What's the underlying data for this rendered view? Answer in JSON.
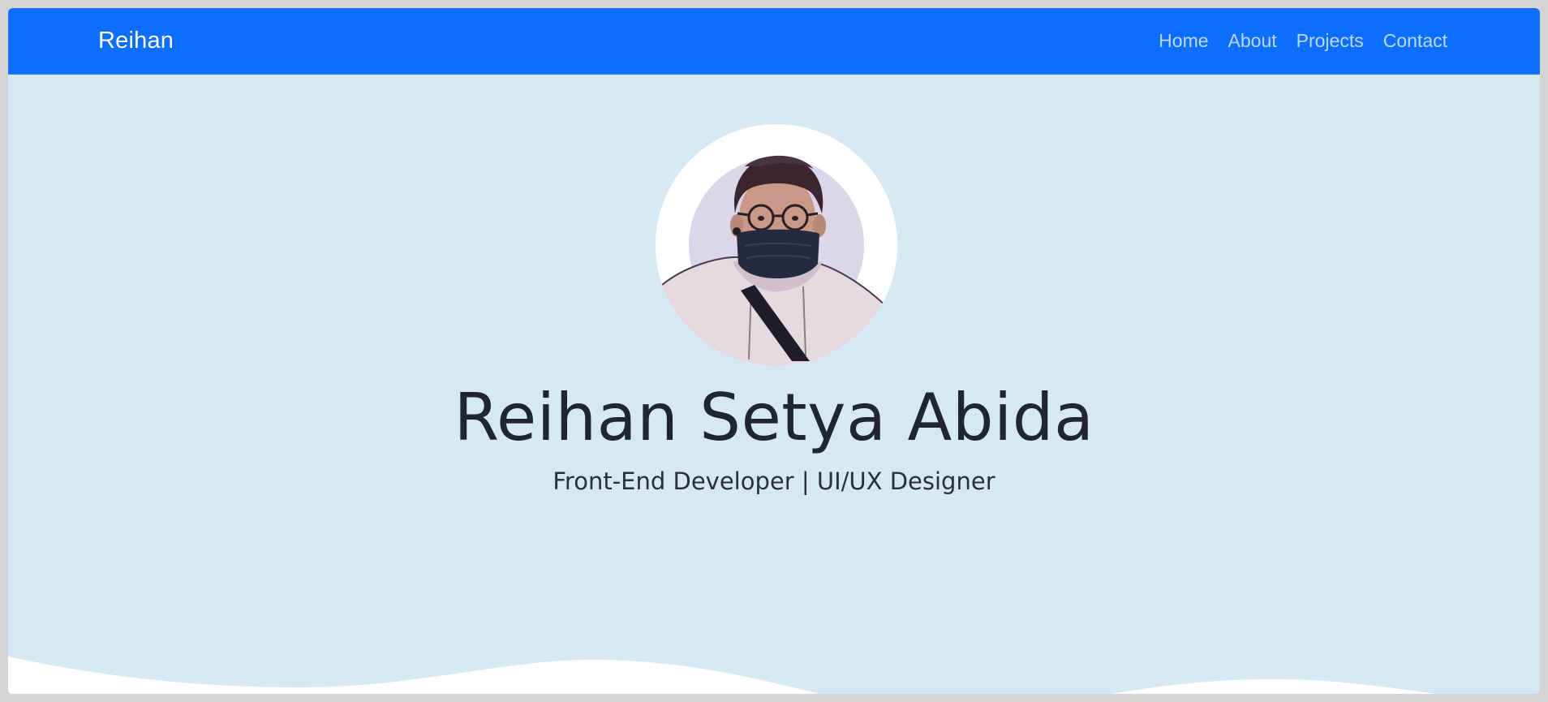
{
  "navbar": {
    "brand": "Reihan",
    "links": [
      {
        "label": "Home"
      },
      {
        "label": "About"
      },
      {
        "label": "Projects"
      },
      {
        "label": "Contact"
      }
    ]
  },
  "hero": {
    "name": "Reihan Setya Abida",
    "subtitle": "Front-End Developer | UI/UX Designer"
  },
  "colors": {
    "navbar_bg": "#0d6efd",
    "hero_bg": "#d7e8f5",
    "wave": "#ffffff",
    "text": "#1f2533"
  }
}
